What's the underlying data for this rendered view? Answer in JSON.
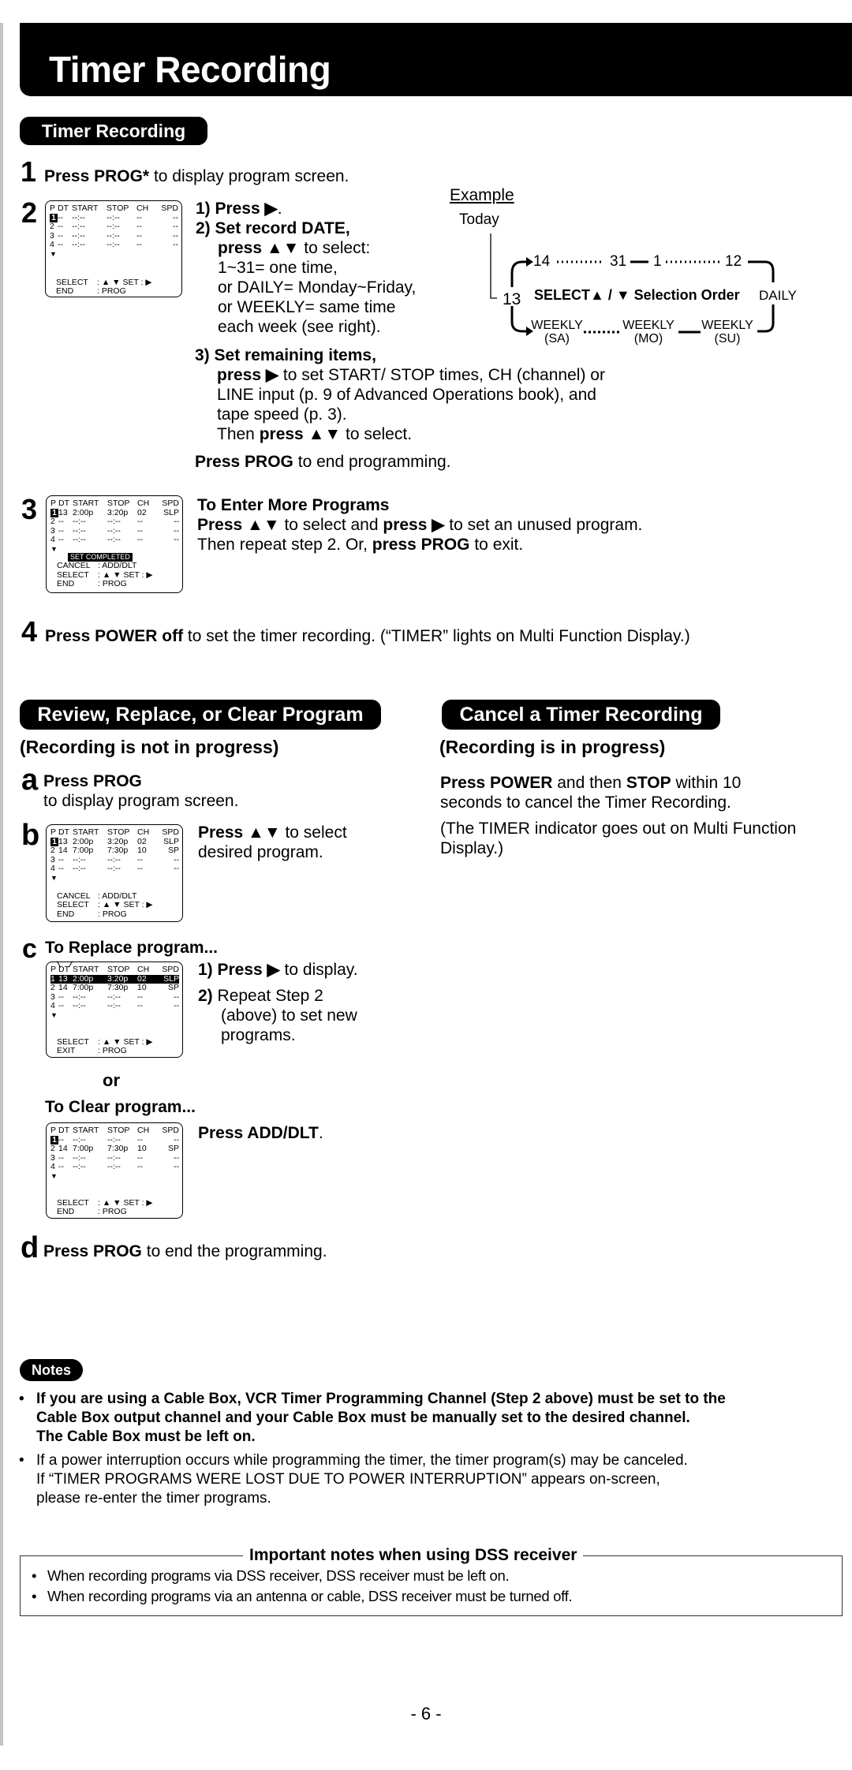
{
  "page": {
    "title": "Timer Recording",
    "page_number": "- 6 -"
  },
  "timer_section": {
    "heading": "Timer Recording",
    "step1": {
      "num": "1",
      "bold": "Press PROG*",
      "rest": " to display program screen."
    },
    "step2": {
      "num": "2",
      "items": [
        {
          "bold": "1) Press ▶",
          "rest": "."
        },
        {
          "bold": "2) Set record DATE,",
          "rest": ""
        }
      ],
      "date_lines": [
        {
          "bold": "press ▲▼",
          "rest": " to select:"
        },
        {
          "bold": "",
          "rest": "1~31= one time,"
        },
        {
          "bold": "",
          "rest": "or DAILY= Monday~Friday,"
        },
        {
          "bold": "",
          "rest": "or WEEKLY= same time"
        },
        {
          "bold": "",
          "rest": "each week (see right)."
        }
      ],
      "item3_title": "3) Set remaining items,",
      "item3_lines": [
        {
          "bold": "press ▶",
          "rest": " to set START/ STOP times, CH (channel) or"
        },
        {
          "bold": "",
          "rest": "LINE input (p. 9 of Advanced Operations book), and"
        },
        {
          "bold": "",
          "rest": "tape speed (p. 3)."
        },
        {
          "pre": "Then ",
          "bold": "press ▲▼",
          "rest": " to select."
        }
      ],
      "end_line": {
        "bold": "Press PROG",
        "rest": " to end programming."
      }
    },
    "example": {
      "title": "Example",
      "today": "Today",
      "today_value": "13",
      "top_sequence": [
        "14",
        "31",
        "1",
        "12"
      ],
      "middle_label_a": "SELECT▲ / ▼ Selection Order",
      "daily": "DAILY",
      "weekly": [
        {
          "label": "WEEKLY",
          "day": "(SA)"
        },
        {
          "label": "WEEKLY",
          "day": "(MO)"
        },
        {
          "label": "WEEKLY",
          "day": "(SU)"
        }
      ]
    },
    "step3": {
      "num": "3",
      "title": "To Enter More Programs",
      "line1": {
        "bold1": "Press ▲▼",
        "mid": " to select and ",
        "bold2": "press ▶",
        "rest": " to set an unused program."
      },
      "line2": {
        "pre": "Then repeat step 2. Or, ",
        "bold": "press PROG",
        "rest": " to exit."
      }
    },
    "step4": {
      "num": "4",
      "bold": "Press POWER off",
      "rest": " to set the timer recording. (“TIMER” lights on Multi Function Display.)"
    }
  },
  "osd_screens": {
    "header": [
      "P",
      "DT",
      "START",
      "STOP",
      "CH",
      "SPD"
    ],
    "empty_row": [
      "--",
      "--:--",
      "--:--",
      "--",
      "--"
    ],
    "scroll_indicator": "▼",
    "set_completed": "SET COMPLETED",
    "footer": {
      "cancel": [
        "CANCEL",
        ": ADD/DLT"
      ],
      "select": [
        "SELECT",
        ": ▲ ▼      SET : ▶"
      ],
      "end": [
        "END",
        ": PROG"
      ],
      "exit": [
        "EXIT",
        ": PROG"
      ]
    },
    "program1": [
      "13",
      "2:00p",
      "3:20p",
      "02",
      "SLP"
    ],
    "program2": [
      "14",
      "7:00p",
      "7:30p",
      "10",
      "SP"
    ]
  },
  "review_section": {
    "heading": "Review, Replace, or Clear Program",
    "subtitle": "(Recording is not in progress)",
    "a": {
      "letter": "a",
      "bold": "Press PROG",
      "rest": "to display program screen."
    },
    "b": {
      "letter": "b",
      "bold": "Press ▲▼",
      "rest": " to select",
      "line2": "desired  program."
    },
    "c": {
      "letter": "c",
      "title": "To Replace program...",
      "item1": {
        "bold": "1) Press ▶",
        "rest": " to display."
      },
      "item2": {
        "bold": "2)",
        "lines": [
          " Repeat Step 2",
          "(above) to set new",
          "programs."
        ]
      },
      "or": "or",
      "clear_title": "To Clear program...",
      "clear_action": {
        "bold": "Press ADD/DLT",
        "rest": "."
      }
    },
    "d": {
      "letter": "d",
      "bold": "Press PROG",
      "rest": " to end the programming."
    }
  },
  "cancel_section": {
    "heading": "Cancel a Timer Recording",
    "subtitle": "(Recording is in progress)",
    "line1": {
      "bold1": "Press POWER",
      "mid": " and then ",
      "bold2": "STOP",
      "rest": " within 10"
    },
    "line2": "seconds to cancel the Timer Recording.",
    "line3": "(The TIMER indicator goes out on Multi Function",
    "line4": "Display.)"
  },
  "notes": {
    "label": "Notes",
    "bold_note": [
      "If you are using a Cable Box, VCR Timer Programming Channel (Step 2 above) must be set to the",
      "Cable Box output channel and your Cable Box must be manually set to the desired channel.",
      "The Cable Box must be left on."
    ],
    "normal_note": [
      "If a power interruption occurs while programming the timer, the timer program(s) may be canceled.",
      "If “TIMER PROGRAMS WERE LOST DUE TO POWER INTERRUPTION” appears on-screen,",
      "please re-enter the timer programs."
    ]
  },
  "dss": {
    "title": "Important notes when using DSS receiver",
    "items": [
      "When recording programs via DSS receiver, DSS receiver must be left on.",
      "When recording programs via an antenna or cable, DSS receiver must be turned off."
    ]
  }
}
